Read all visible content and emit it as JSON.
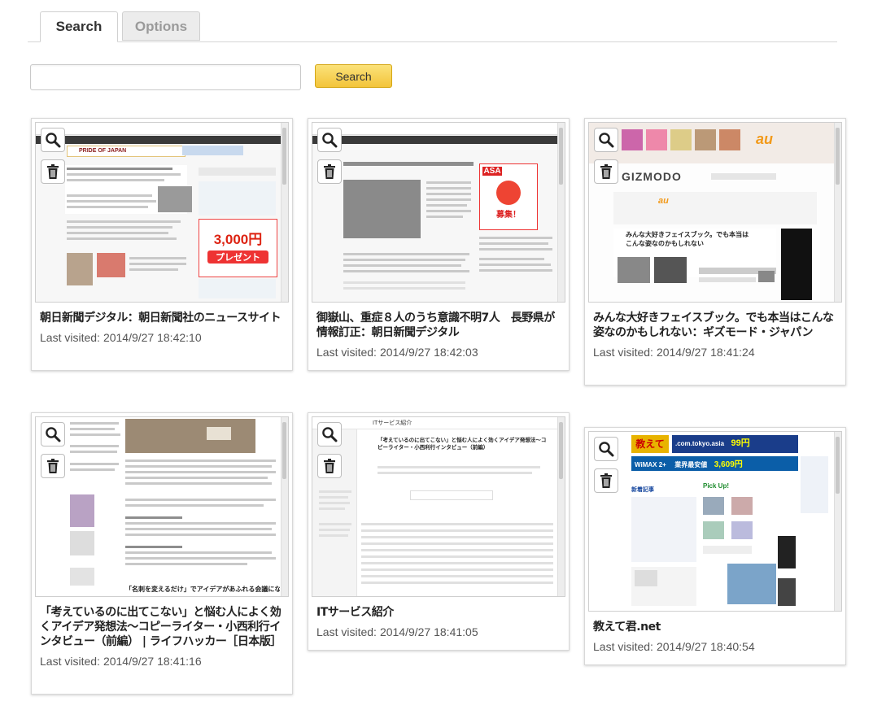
{
  "tabs": [
    {
      "label": "Search",
      "active": true
    },
    {
      "label": "Options",
      "active": false
    }
  ],
  "search": {
    "value": "",
    "placeholder": "",
    "button_label": "Search"
  },
  "colors": {
    "accent_button": "#f3c43a",
    "tab_inactive_text": "#9a9a9a",
    "card_border": "#d8d8d8"
  },
  "icons": {
    "zoom": "magnifier-icon",
    "delete": "trash-icon"
  },
  "cards": [
    {
      "title": "朝日新聞デジタル：朝日新聞社のニュースサイト",
      "visited_label": "Last visited:",
      "visited": "2014/9/27 18:42:10",
      "thumb_text": [
        "PRIDE OF JAPAN",
        "3,000円",
        "プレゼント"
      ]
    },
    {
      "title": "御嶽山、重症８人のうち意識不明7人　長野県が情報訂正：朝日新聞デジタル",
      "visited_label": "Last visited:",
      "visited": "2014/9/27 18:42:03",
      "thumb_text": [
        "ASA",
        "募集！"
      ]
    },
    {
      "title": "みんな大好きフェイスブック。でも本当はこんな姿なのかもしれない：ギズモード・ジャパン",
      "visited_label": "Last visited:",
      "visited": "2014/9/27 18:41:24",
      "thumb_text": [
        "GIZMODO",
        "au",
        "みんな大好きフェイスブック。でも本当は",
        "こんな姿なのかもしれない"
      ]
    },
    {
      "title": "「考えているのに出てこない」と悩む人によく効くアイデア発想法～コピーライター・小西利行インタビュー（前編） | ライフハッカー［日本版］",
      "visited_label": "Last visited:",
      "visited": "2014/9/27 18:41:16",
      "thumb_text": [
        "「名刺を変えるだけ」でアイデアがあふれる会議になる理由"
      ]
    },
    {
      "title": "ITサービス紹介",
      "visited_label": "Last visited:",
      "visited": "2014/9/27 18:41:05",
      "thumb_text": [
        "ITサービス紹介",
        "「考えているのに出てこない」と悩む人によく効くアイデア発想法～コ",
        "ピーライター・小西利行インタビュー（前編）"
      ]
    },
    {
      "title": "教えて君.net",
      "visited_label": "Last visited:",
      "visited": "2014/9/27 18:40:54",
      "thumb_text": [
        "教えて君",
        ".com.tokyo.asia",
        "99円",
        "WiMAX 2+",
        "3,609円",
        "業界最安値",
        "Pick Up!",
        "新着記事"
      ]
    }
  ]
}
